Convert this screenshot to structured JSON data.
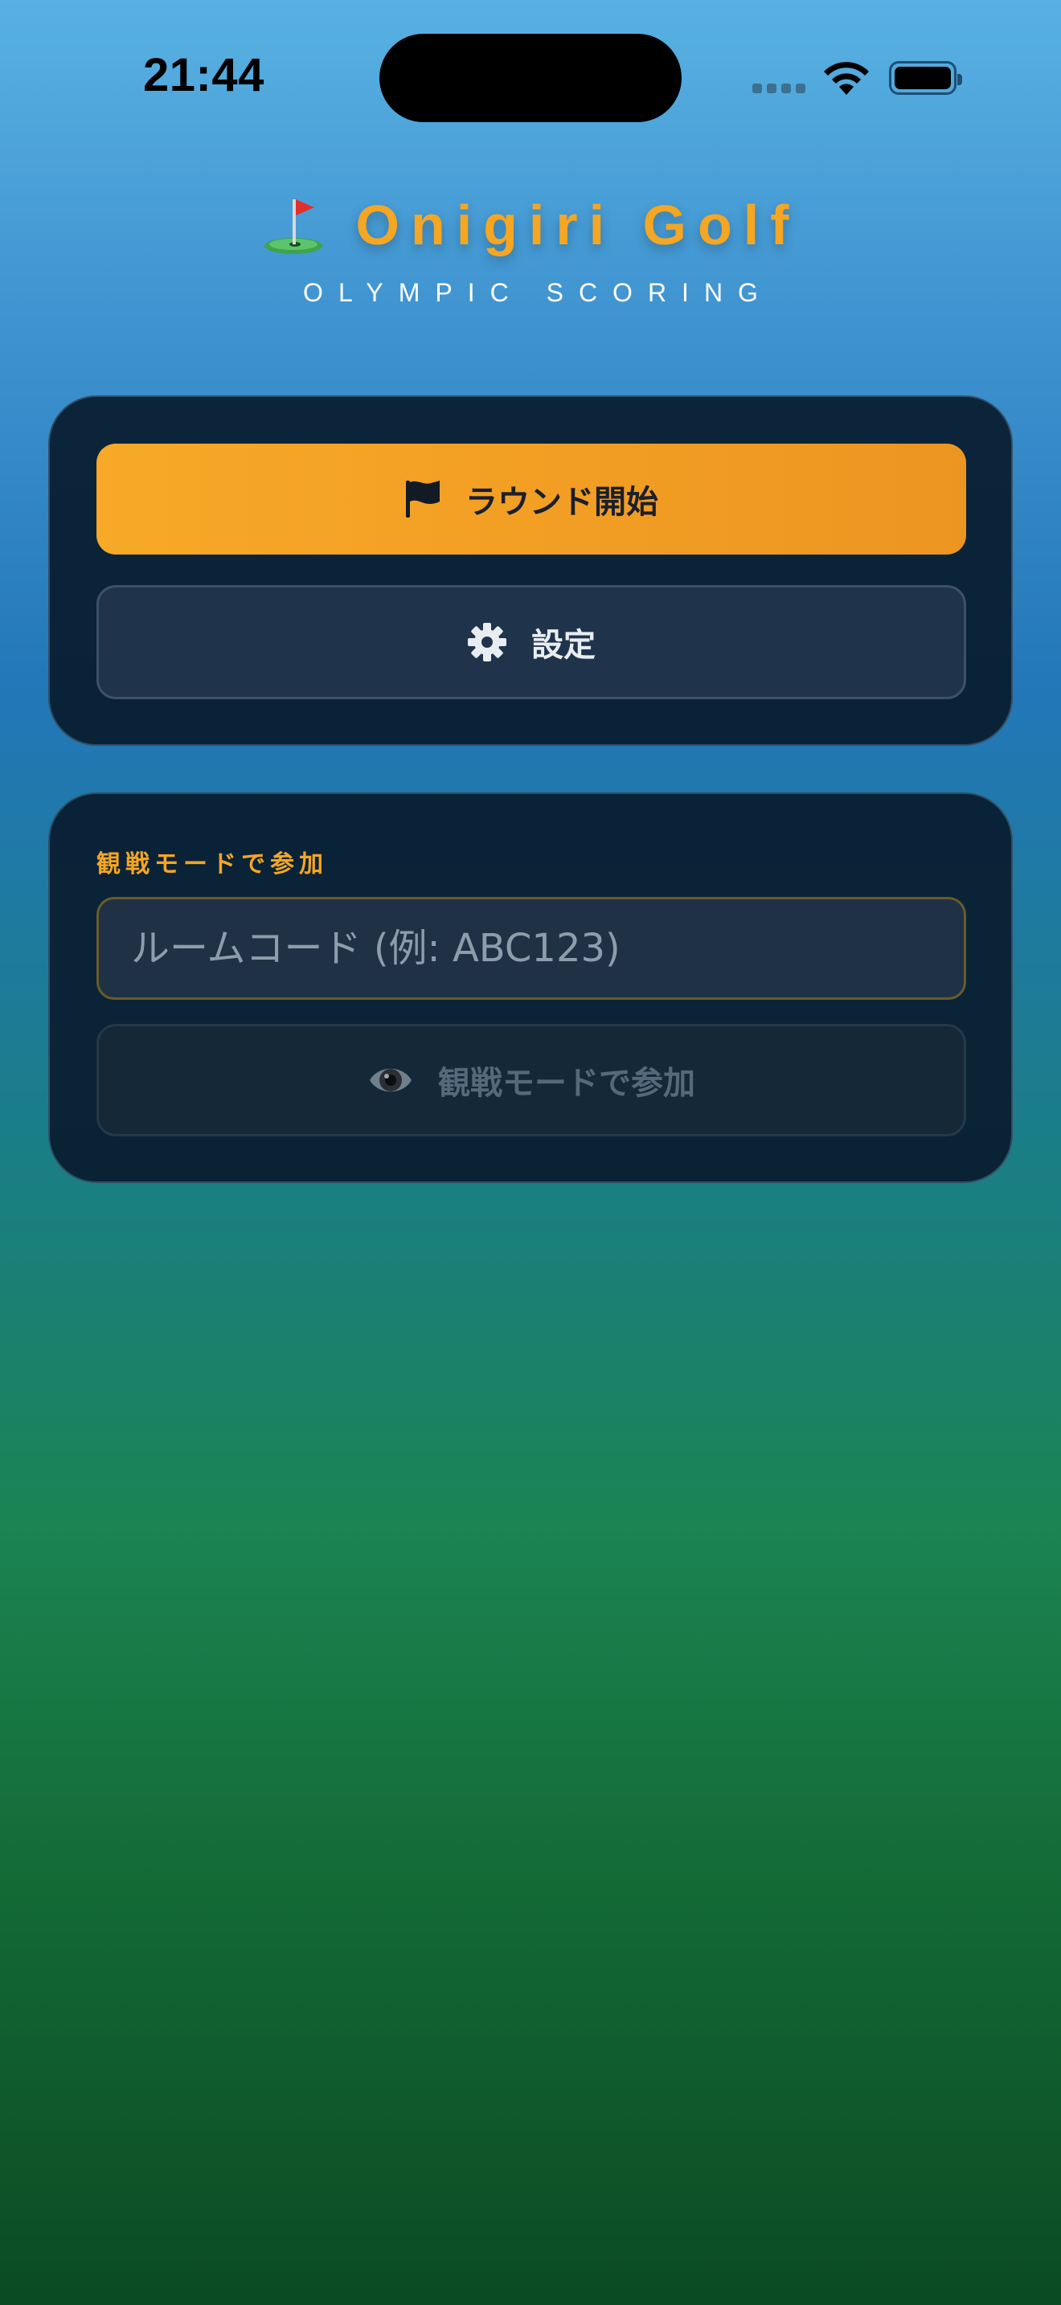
{
  "status_bar": {
    "time": "21:44",
    "icons": [
      "signal-icon",
      "wifi-icon",
      "battery-icon"
    ]
  },
  "header": {
    "title": "Onigiri Golf",
    "subtitle": "OLYMPIC SCORING",
    "icon": "golf-flag-icon"
  },
  "actions": {
    "start_round_label": "ラウンド開始",
    "start_round_icon": "flag-icon",
    "settings_label": "設定",
    "settings_icon": "gear-icon"
  },
  "spectate": {
    "section_label": "観戦モードで参加",
    "room_code_placeholder": "ルームコード (例: ABC123)",
    "room_code_value": "",
    "join_button_label": "観戦モードで参加",
    "join_button_icon": "eye-icon"
  },
  "colors": {
    "accent": "#f5a623",
    "card_background": "#091c2e",
    "settings_button": "#1f344b"
  }
}
